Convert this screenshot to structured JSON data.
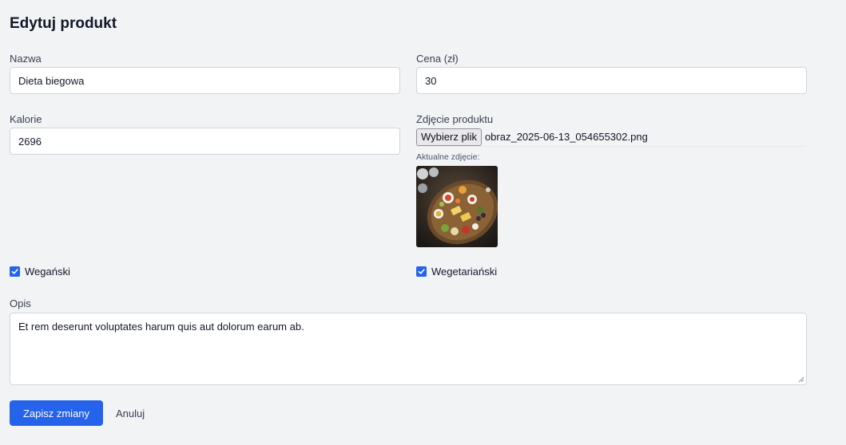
{
  "page": {
    "title": "Edytuj produkt"
  },
  "form": {
    "name": {
      "label": "Nazwa",
      "value": "Dieta biegowa"
    },
    "price": {
      "label": "Cena (zł)",
      "value": "30"
    },
    "calories": {
      "label": "Kalorie",
      "value": "2696"
    },
    "photo": {
      "label": "Zdjęcie produktu",
      "button_label": "Wybierz plik",
      "file_name": "obraz_2025-06-13_054655302.png",
      "current_label": "Aktualne zdjęcie:"
    },
    "vegan": {
      "label": "Wegański",
      "checked": true
    },
    "vegetarian": {
      "label": "Wegetariański",
      "checked": true
    },
    "description": {
      "label": "Opis",
      "value": "Et rem deserunt voluptates harum quis aut dolorum earum ab."
    }
  },
  "actions": {
    "save_label": "Zapisz zmiany",
    "cancel_label": "Anuluj"
  },
  "colors": {
    "accent": "#2563eb",
    "background": "#f2f3f5"
  }
}
